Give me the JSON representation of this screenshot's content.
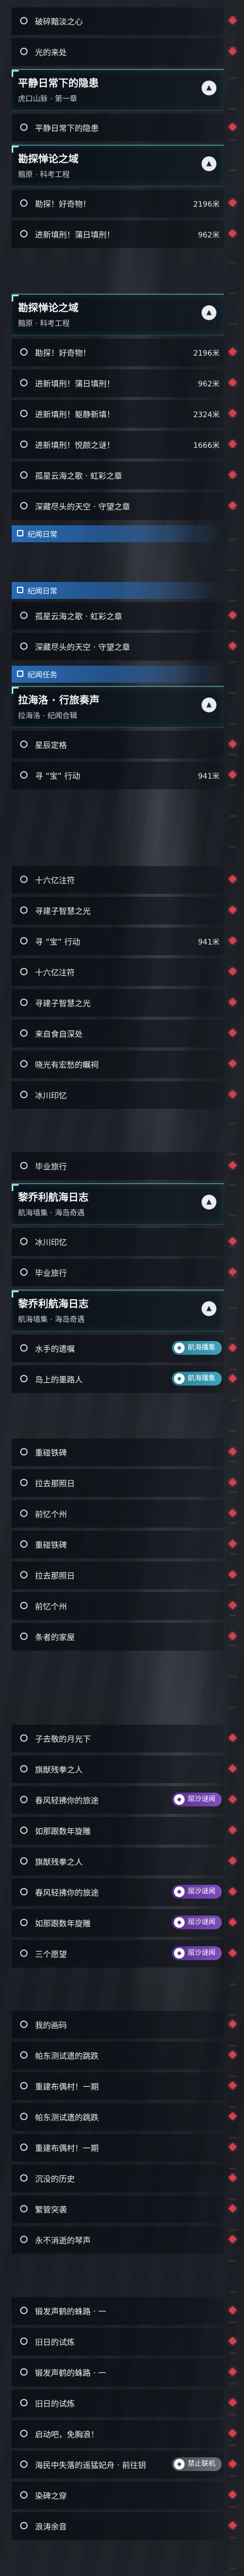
{
  "screens": [
    {
      "rows": [
        {
          "kind": "task",
          "title": "破碎黯淡之心"
        },
        {
          "kind": "task",
          "title": "光的来处"
        },
        {
          "kind": "header",
          "title": "平静日常下的隐患",
          "subtitle": "虎口山脉 · 第一章"
        },
        {
          "kind": "task",
          "title": "平静日常下的隐患"
        },
        {
          "kind": "header",
          "title": "勘探惮论之域",
          "subtitle": "黯原 · 科考工程"
        },
        {
          "kind": "task",
          "title": "勘探！好奇物！",
          "distance": "2196米"
        },
        {
          "kind": "task",
          "title": "进新填刑！蒲日填刑！",
          "distance": "962米"
        }
      ]
    },
    {
      "rows": [
        {
          "kind": "header",
          "title": "勘探惮论之域",
          "subtitle": "黯原 · 科考工程"
        },
        {
          "kind": "task",
          "title": "勘探！好奇物！",
          "distance": "2196米"
        },
        {
          "kind": "task",
          "title": "进新填刑！蒲日填刑！",
          "distance": "962米"
        },
        {
          "kind": "task",
          "title": "进新填刑！躯静新填！",
          "distance": "2324米"
        },
        {
          "kind": "task",
          "title": "进新填刑！悦颜之谜！",
          "distance": "1666米"
        },
        {
          "kind": "task",
          "title": "孤星云海之歌 · 虹彩之章"
        },
        {
          "kind": "task",
          "title": "深藏尽头的天空 · 守望之章"
        },
        {
          "kind": "banner",
          "title": "纪闻日常"
        }
      ]
    },
    {
      "rows": [
        {
          "kind": "banner",
          "title": "纪闻日常"
        },
        {
          "kind": "task",
          "title": "孤星云海之歌 · 虹彩之章"
        },
        {
          "kind": "task",
          "title": "深藏尽头的天空 · 守望之章"
        },
        {
          "kind": "banner",
          "title": "纪闻任务"
        },
        {
          "kind": "header",
          "title": "拉海洛 · 行旅奏声",
          "subtitle": "拉海洛 · 纪闻合辑"
        },
        {
          "kind": "task",
          "title": "星辰定格"
        },
        {
          "kind": "task",
          "title": "寻 “宝” 行动",
          "distance": "941米"
        }
      ]
    },
    {
      "rows": [
        {
          "kind": "task",
          "title": "十六亿注符"
        },
        {
          "kind": "task",
          "title": "寻建子智慧之光"
        },
        {
          "kind": "task",
          "title": "寻 “宝” 行动",
          "distance": "941米"
        },
        {
          "kind": "task",
          "title": "十六亿注符"
        },
        {
          "kind": "task",
          "title": "寻建子智慧之光"
        },
        {
          "kind": "task",
          "title": "来自食自深处"
        },
        {
          "kind": "task",
          "title": "晓光有宏愁的瞩祠"
        },
        {
          "kind": "task",
          "title": "冰川印忆"
        }
      ]
    },
    {
      "rows": [
        {
          "kind": "task",
          "title": "毕业旅行"
        },
        {
          "kind": "header",
          "title": "黎乔利航海日志",
          "subtitle": "航海墙集 · 海岛奇遇"
        },
        {
          "kind": "task",
          "title": "冰川印忆"
        },
        {
          "kind": "task",
          "title": "毕业旅行"
        },
        {
          "kind": "header",
          "title": "黎乔利航海日志",
          "subtitle": "航海墙集 · 海岛奇遇"
        },
        {
          "kind": "task",
          "title": "水手的遗嘱",
          "tag": "航海播集",
          "tone": "teal"
        },
        {
          "kind": "task",
          "title": "岛上的墨路人",
          "tag": "航海播集",
          "tone": "teal"
        }
      ]
    },
    {
      "rows": [
        {
          "kind": "task",
          "title": "重碰铁碑"
        },
        {
          "kind": "task",
          "title": "拉去那照日"
        },
        {
          "kind": "task",
          "title": "前忆个州"
        },
        {
          "kind": "task",
          "title": "重碰铁碑"
        },
        {
          "kind": "task",
          "title": "拉去那照日"
        },
        {
          "kind": "task",
          "title": "前忆个州"
        },
        {
          "kind": "task",
          "title": "条者的家屋"
        }
      ]
    },
    {
      "rows": [
        {
          "kind": "task",
          "title": "子去敬的月光下"
        },
        {
          "kind": "task",
          "title": "旗猷残拳之人"
        },
        {
          "kind": "task",
          "title": "春风轻拂你的旅途",
          "tag": "屈沙谜闻",
          "tone": "purple"
        },
        {
          "kind": "task",
          "title": "如那跟数年旋雕"
        },
        {
          "kind": "task",
          "title": "旗猷残拳之人"
        },
        {
          "kind": "task",
          "title": "春风轻拂你的旅途",
          "tag": "屈沙谜闻",
          "tone": "purple"
        },
        {
          "kind": "task",
          "title": "如那跟数年旋雕",
          "tag": "屈沙谜闻",
          "tone": "purple"
        },
        {
          "kind": "task",
          "title": "三个愿望",
          "tag": "屈沙谜闻",
          "tone": "purple"
        }
      ]
    },
    {
      "rows": [
        {
          "kind": "task",
          "title": "我的画码"
        },
        {
          "kind": "task",
          "title": "帕东测试遗的跳跌"
        },
        {
          "kind": "task",
          "title": "重建布偶村！一期"
        },
        {
          "kind": "task",
          "title": "帕东测试遗的跳跌"
        },
        {
          "kind": "task",
          "title": "重建布偶村！一期"
        },
        {
          "kind": "task",
          "title": "沉没的历史"
        },
        {
          "kind": "task",
          "title": "繁管突袭"
        },
        {
          "kind": "task",
          "title": "永不消逝的琴声"
        }
      ]
    },
    {
      "rows": [
        {
          "kind": "task",
          "title": "锻发声鹤的蛛路 · 一"
        },
        {
          "kind": "task",
          "title": "旧日的试炼"
        },
        {
          "kind": "task",
          "title": "锻发声鹤的蛛路 · 一"
        },
        {
          "kind": "task",
          "title": "旧日的试炼"
        },
        {
          "kind": "task",
          "title": "启动吧，免胸浪！"
        },
        {
          "kind": "task",
          "title": "海民中失落的遥猛妃舟 · 前往钥",
          "tag": "禁止联机",
          "tone": "gray"
        },
        {
          "kind": "task",
          "title": "染碑之穿"
        },
        {
          "kind": "task",
          "title": "浪涛余音"
        }
      ]
    }
  ]
}
